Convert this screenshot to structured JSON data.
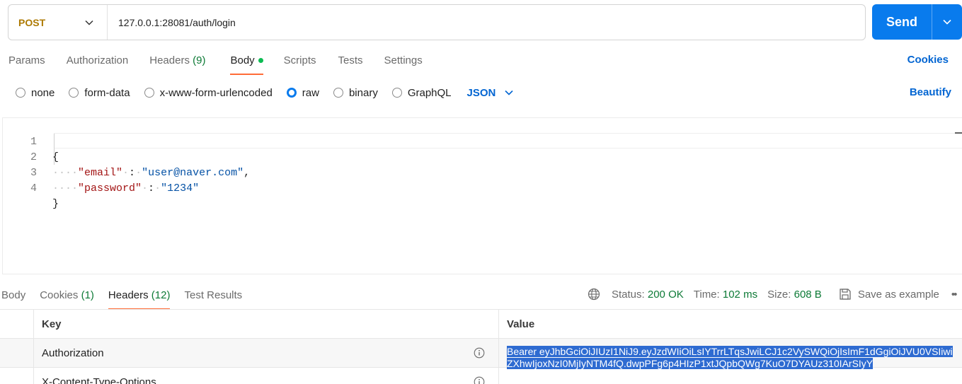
{
  "request": {
    "method": "POST",
    "url": "127.0.0.1:28081/auth/login",
    "send_label": "Send"
  },
  "request_tabs": [
    {
      "label": "Params",
      "count": ""
    },
    {
      "label": "Authorization",
      "count": ""
    },
    {
      "label": "Headers",
      "count": "(9)"
    },
    {
      "label": "Body",
      "count": ""
    },
    {
      "label": "Scripts",
      "count": ""
    },
    {
      "label": "Tests",
      "count": ""
    },
    {
      "label": "Settings",
      "count": ""
    }
  ],
  "cookies_label": "Cookies",
  "body_types": [
    "none",
    "form-data",
    "x-www-form-urlencoded",
    "raw",
    "binary",
    "GraphQL"
  ],
  "body_format": "JSON",
  "beautify_label": "Beautify",
  "editor": {
    "line_numbers": [
      "1",
      "2",
      "3",
      "4"
    ],
    "open_brace": "{",
    "close_brace": "}",
    "email_key": "\"email\"",
    "email_value": "\"user@naver.com\"",
    "password_key": "\"password\"",
    "password_value": "\"1234\""
  },
  "response_tabs": [
    {
      "label": "Body",
      "count": ""
    },
    {
      "label": "Cookies",
      "count": "(1)"
    },
    {
      "label": "Headers",
      "count": "(12)"
    },
    {
      "label": "Test Results",
      "count": ""
    }
  ],
  "response_meta": {
    "status_label": "Status:",
    "status_value": "200 OK",
    "time_label": "Time:",
    "time_value": "102 ms",
    "size_label": "Size:",
    "size_value": "608 B",
    "save_label": "Save as example"
  },
  "headers_table": {
    "key_header": "Key",
    "value_header": "Value",
    "rows": [
      {
        "key": "Authorization",
        "value": "Bearer eyJhbGciOiJIUzI1NiJ9.eyJzdWIiOiLsIYTrrLTqsJwiLCJ1c2VySWQiOjIsImF1dGgiOiJVU0VSIiwiZXhwIjoxNzI0MjIyNTM4fQ.dwpPFg6p4HIzP1xtJQpbQWg7KuO7DYAUz310IArSIyY"
      },
      {
        "key": "X-Content-Type-Options",
        "value": ""
      }
    ]
  },
  "colors": {
    "accent": "#097bed",
    "method_post": "#ad7a03",
    "active_tab_underline": "#ff6c37",
    "success": "#0d7a36",
    "link": "#0265d2",
    "selection": "#2e6bd1"
  }
}
